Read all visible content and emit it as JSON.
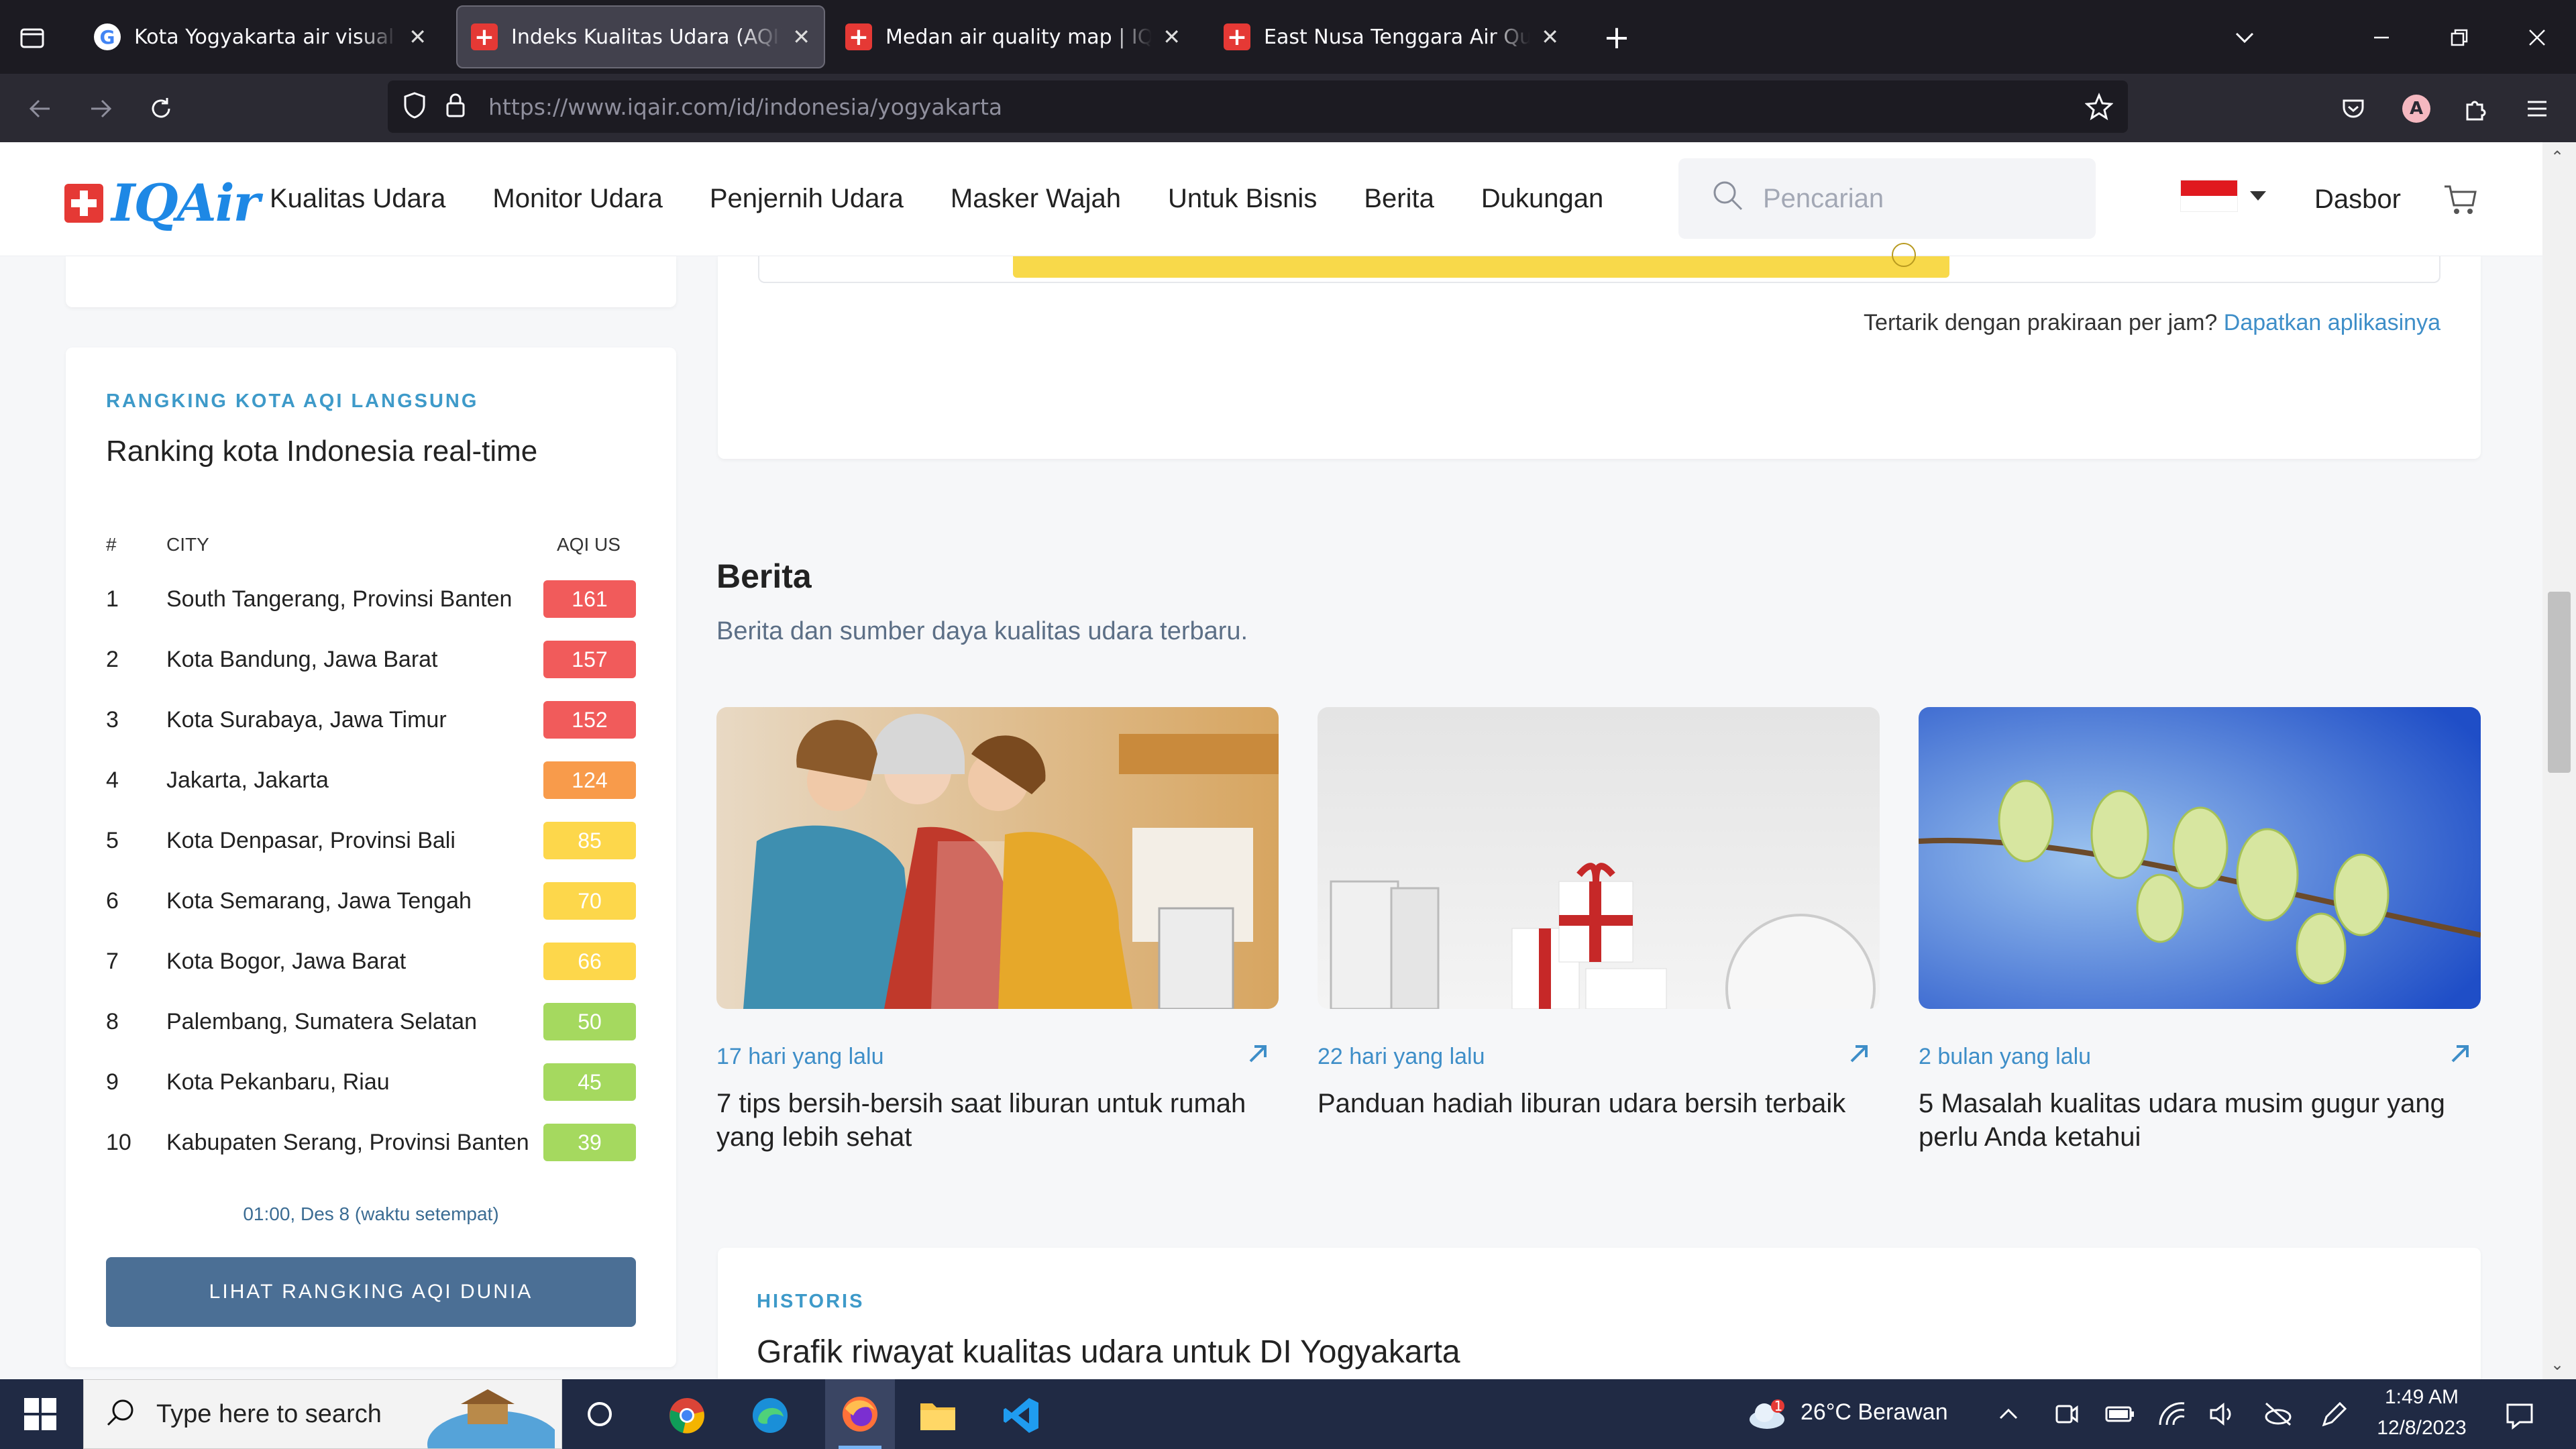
{
  "browser": {
    "tabs": [
      {
        "title": "Kota Yogyakarta air visual - Goo",
        "favicon": "google-icon"
      },
      {
        "title": "Indeks Kualitas Udara (AQI) Yog",
        "favicon": "iqair-icon",
        "active": true
      },
      {
        "title": "Medan air quality map | IQAir",
        "favicon": "iqair-icon"
      },
      {
        "title": "East Nusa Tenggara Air Quality",
        "favicon": "iqair-icon"
      }
    ],
    "url": "https://www.iqair.com/id/indonesia/yogyakarta",
    "profile_initial": "A"
  },
  "site": {
    "logo_text": "IQAir",
    "nav": [
      "Kualitas Udara",
      "Monitor Udara",
      "Penjernih Udara",
      "Masker Wajah",
      "Untuk Bisnis",
      "Berita",
      "Dukungan"
    ],
    "search_placeholder": "Pencarian",
    "dashboard_label": "Dasbor"
  },
  "forecast": {
    "prompt": "Tertarik dengan prakiraan per jam?",
    "link": "Dapatkan aplikasinya"
  },
  "ranking": {
    "eyebrow": "RANGKING KOTA AQI LANGSUNG",
    "title": "Ranking kota Indonesia real-time",
    "col_rank": "#",
    "col_city": "CITY",
    "col_aqi": "AQI US",
    "rows": [
      {
        "rank": "1",
        "city": "South Tangerang, Provinsi Banten",
        "aqi": "161",
        "color": "#f15b5b"
      },
      {
        "rank": "2",
        "city": "Kota Bandung, Jawa Barat",
        "aqi": "157",
        "color": "#f15b5b"
      },
      {
        "rank": "3",
        "city": "Kota Surabaya, Jawa Timur",
        "aqi": "152",
        "color": "#f15b5b"
      },
      {
        "rank": "4",
        "city": "Jakarta, Jakarta",
        "aqi": "124",
        "color": "#f89b4b"
      },
      {
        "rank": "5",
        "city": "Kota Denpasar, Provinsi Bali",
        "aqi": "85",
        "color": "#fdd74b"
      },
      {
        "rank": "6",
        "city": "Kota Semarang, Jawa Tengah",
        "aqi": "70",
        "color": "#fdd74b"
      },
      {
        "rank": "7",
        "city": "Kota Bogor, Jawa Barat",
        "aqi": "66",
        "color": "#fdd74b"
      },
      {
        "rank": "8",
        "city": "Palembang, Sumatera Selatan",
        "aqi": "50",
        "color": "#a5d95f"
      },
      {
        "rank": "9",
        "city": "Kota Pekanbaru, Riau",
        "aqi": "45",
        "color": "#a5d95f"
      },
      {
        "rank": "10",
        "city": "Kabupaten Serang, Provinsi Banten",
        "aqi": "39",
        "color": "#a5d95f"
      }
    ],
    "timestamp": "01:00, Des 8 (waktu setempat)",
    "button": "LIHAT RANGKING AQI DUNIA"
  },
  "news": {
    "title": "Berita",
    "subtitle": "Berita dan sumber daya kualitas udara terbaru.",
    "items": [
      {
        "age": "17 hari yang lalu",
        "title": "7 tips bersih-bersih saat liburan untuk rumah yang lebih sehat"
      },
      {
        "age": "22 hari yang lalu",
        "title": "Panduan hadiah liburan udara bersih terbaik"
      },
      {
        "age": "2 bulan yang lalu",
        "title": "5 Masalah kualitas udara musim gugur yang perlu Anda ketahui"
      }
    ]
  },
  "history": {
    "eyebrow": "HISTORIS",
    "title": "Grafik riwayat kualitas udara untuk DI Yogyakarta"
  },
  "taskbar": {
    "search_placeholder": "Type here to search",
    "weather": "26°C  Berawan",
    "weather_badge": "1",
    "time": "1:49 AM",
    "date": "12/8/2023"
  }
}
